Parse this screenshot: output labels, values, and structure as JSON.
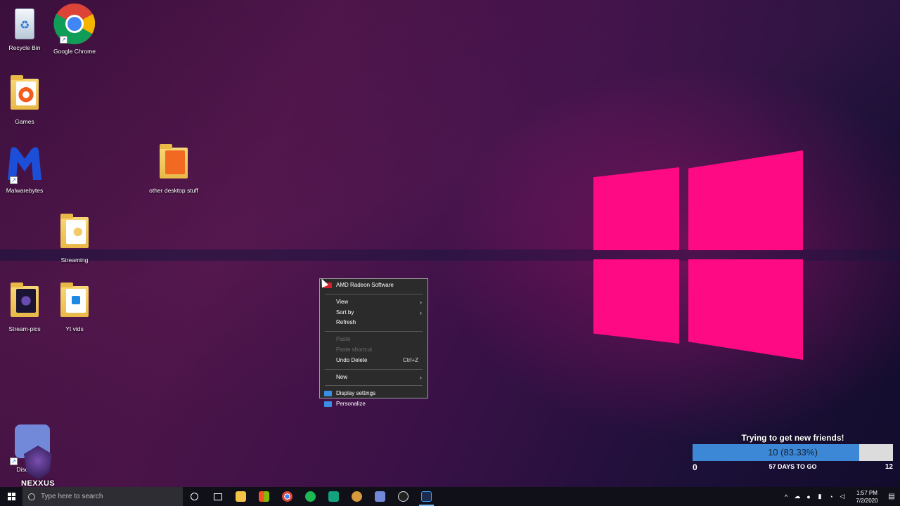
{
  "desktop": {
    "icons": [
      {
        "label": "Recycle Bin"
      },
      {
        "label": "Google Chrome"
      },
      {
        "label": "Games"
      },
      {
        "label": "Malwarebytes"
      },
      {
        "label": "other desktop stuff"
      },
      {
        "label": "Streaming"
      },
      {
        "label": "Stream-pics"
      },
      {
        "label": "Yt vids"
      },
      {
        "label": "Disc..."
      }
    ]
  },
  "context_menu": {
    "items": [
      {
        "label": "AMD Radeon Software"
      },
      {
        "label": "View"
      },
      {
        "label": "Sort by"
      },
      {
        "label": "Refresh"
      },
      {
        "label": "Paste"
      },
      {
        "label": "Paste shortcut"
      },
      {
        "label": "Undo Delete",
        "shortcut": "Ctrl+Z"
      },
      {
        "label": "New"
      },
      {
        "label": "Display settings"
      },
      {
        "label": "Personalize"
      }
    ]
  },
  "widget": {
    "title": "Trying to get new friends!",
    "value_text": "10 (83.33%)",
    "progress_fraction": 0.8333,
    "min": "0",
    "days_left": "57 DAYS TO GO",
    "max": "12",
    "fill_color": "#3d88d6"
  },
  "overlay": {
    "text": "NEXXUS"
  },
  "taskbar": {
    "search_placeholder": "Type here to search",
    "icons": [
      "cortana-icon",
      "task-view-icon",
      "file-explorer-icon",
      "store-icon",
      "chrome-icon",
      "spotify-icon",
      "gamepad-app-icon",
      "anchor-app-icon",
      "discord-icon",
      "obs-icon",
      "streaming-app-icon"
    ],
    "clock_time": "1:57 PM",
    "clock_date": "7/2/2020"
  },
  "colors": {
    "logo_pink": "#ff0a85",
    "menu_bg": "#2b2b2b",
    "taskbar_bg": "#101019"
  }
}
